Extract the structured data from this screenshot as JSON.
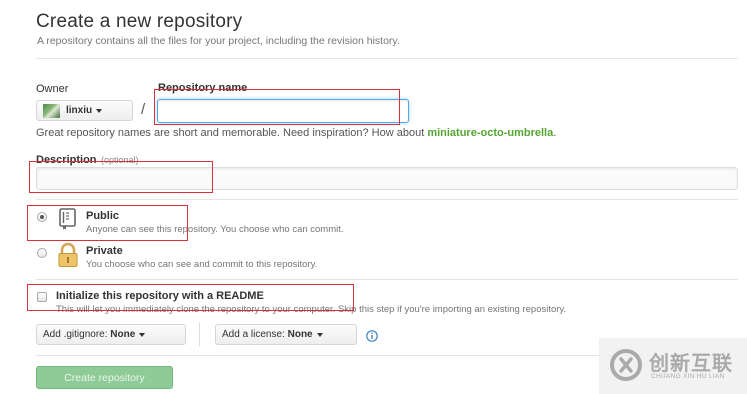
{
  "page": {
    "title": "Create a new repository",
    "subtitle": "A repository contains all the files for your project, including the revision history."
  },
  "owner": {
    "label": "Owner",
    "name": "linxiu"
  },
  "repo": {
    "label": "Repository name",
    "separator": "/",
    "value": "",
    "hint_prefix": "Great repository names are short and memorable. Need inspiration? How about ",
    "suggestion": "miniature-octo-umbrella",
    "hint_suffix": "."
  },
  "description": {
    "label": "Description",
    "optional": "(optional)",
    "value": ""
  },
  "visibility": {
    "public": {
      "title": "Public",
      "desc": "Anyone can see this repository. You choose who can commit.",
      "selected": true
    },
    "private": {
      "title": "Private",
      "desc": "You choose who can see and commit to this repository.",
      "selected": false
    }
  },
  "init": {
    "title": "Initialize this repository with a README",
    "desc": "This will let you immediately clone the repository to your computer. Skip this step if you're importing an existing repository.",
    "checked": false
  },
  "gitignore": {
    "label": "Add .gitignore:",
    "value": "None"
  },
  "license": {
    "label": "Add a license:",
    "value": "None"
  },
  "submit": {
    "label": "Create repository"
  },
  "watermark": {
    "text": "创新互联",
    "subtext": "CHUANG XIN HU LIAN"
  },
  "colors": {
    "accent": "#51a7e8",
    "suggestion": "#55a532",
    "annotation": "#d9303a",
    "button": "#8fcb96"
  }
}
